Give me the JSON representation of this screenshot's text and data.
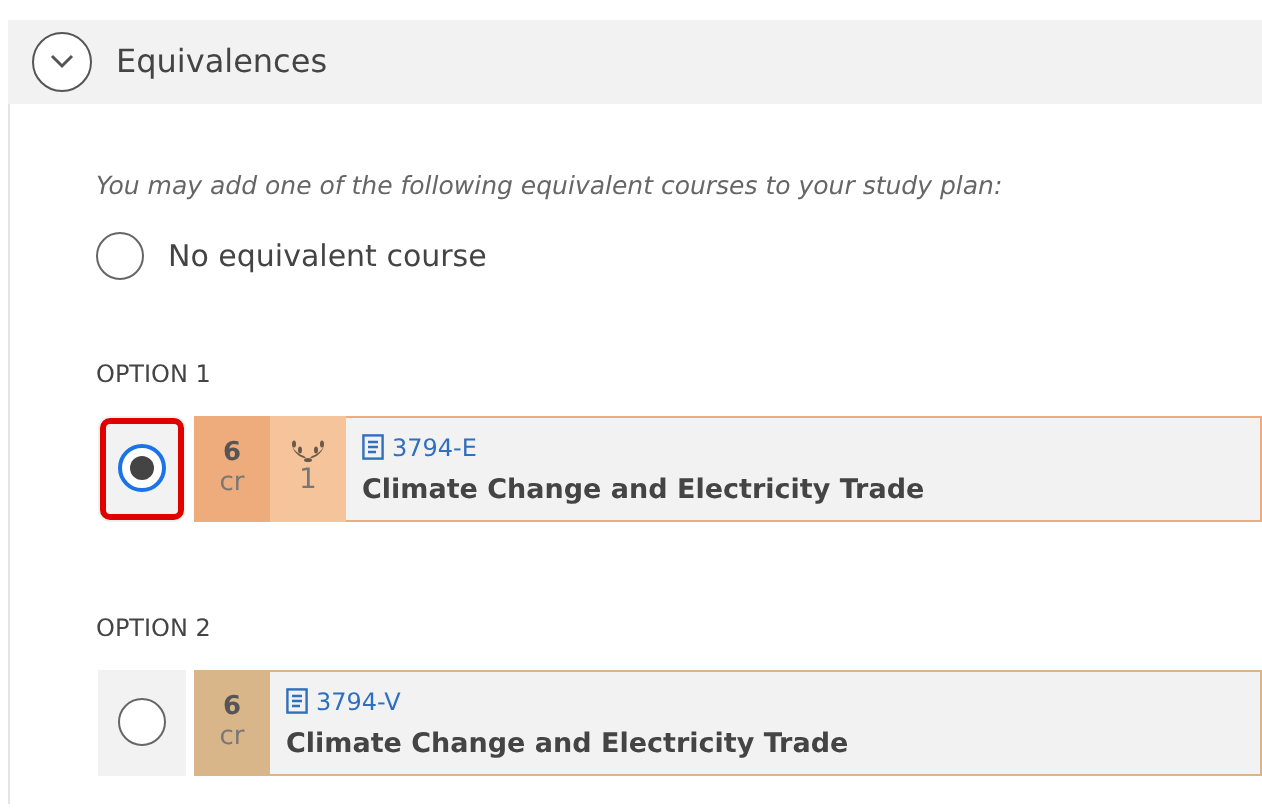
{
  "section": {
    "title": "Equivalences",
    "expanded": true
  },
  "intro": "You may add one of the following equivalent courses to your study plan:",
  "none_option": {
    "label": "No equivalent course",
    "selected": false
  },
  "options": [
    {
      "heading": "OPTION 1",
      "selected": true,
      "highlighted": true,
      "credits": "6",
      "credit_unit": "cr",
      "color": "#eeab7b",
      "level": "1",
      "code": "3794-E",
      "title": "Climate Change and Electricity Trade"
    },
    {
      "heading": "OPTION 2",
      "selected": false,
      "highlighted": false,
      "credits": "6",
      "credit_unit": "cr",
      "color": "#d9b68a",
      "code": "3794-V",
      "title": "Climate Change and Electricity Trade"
    }
  ]
}
